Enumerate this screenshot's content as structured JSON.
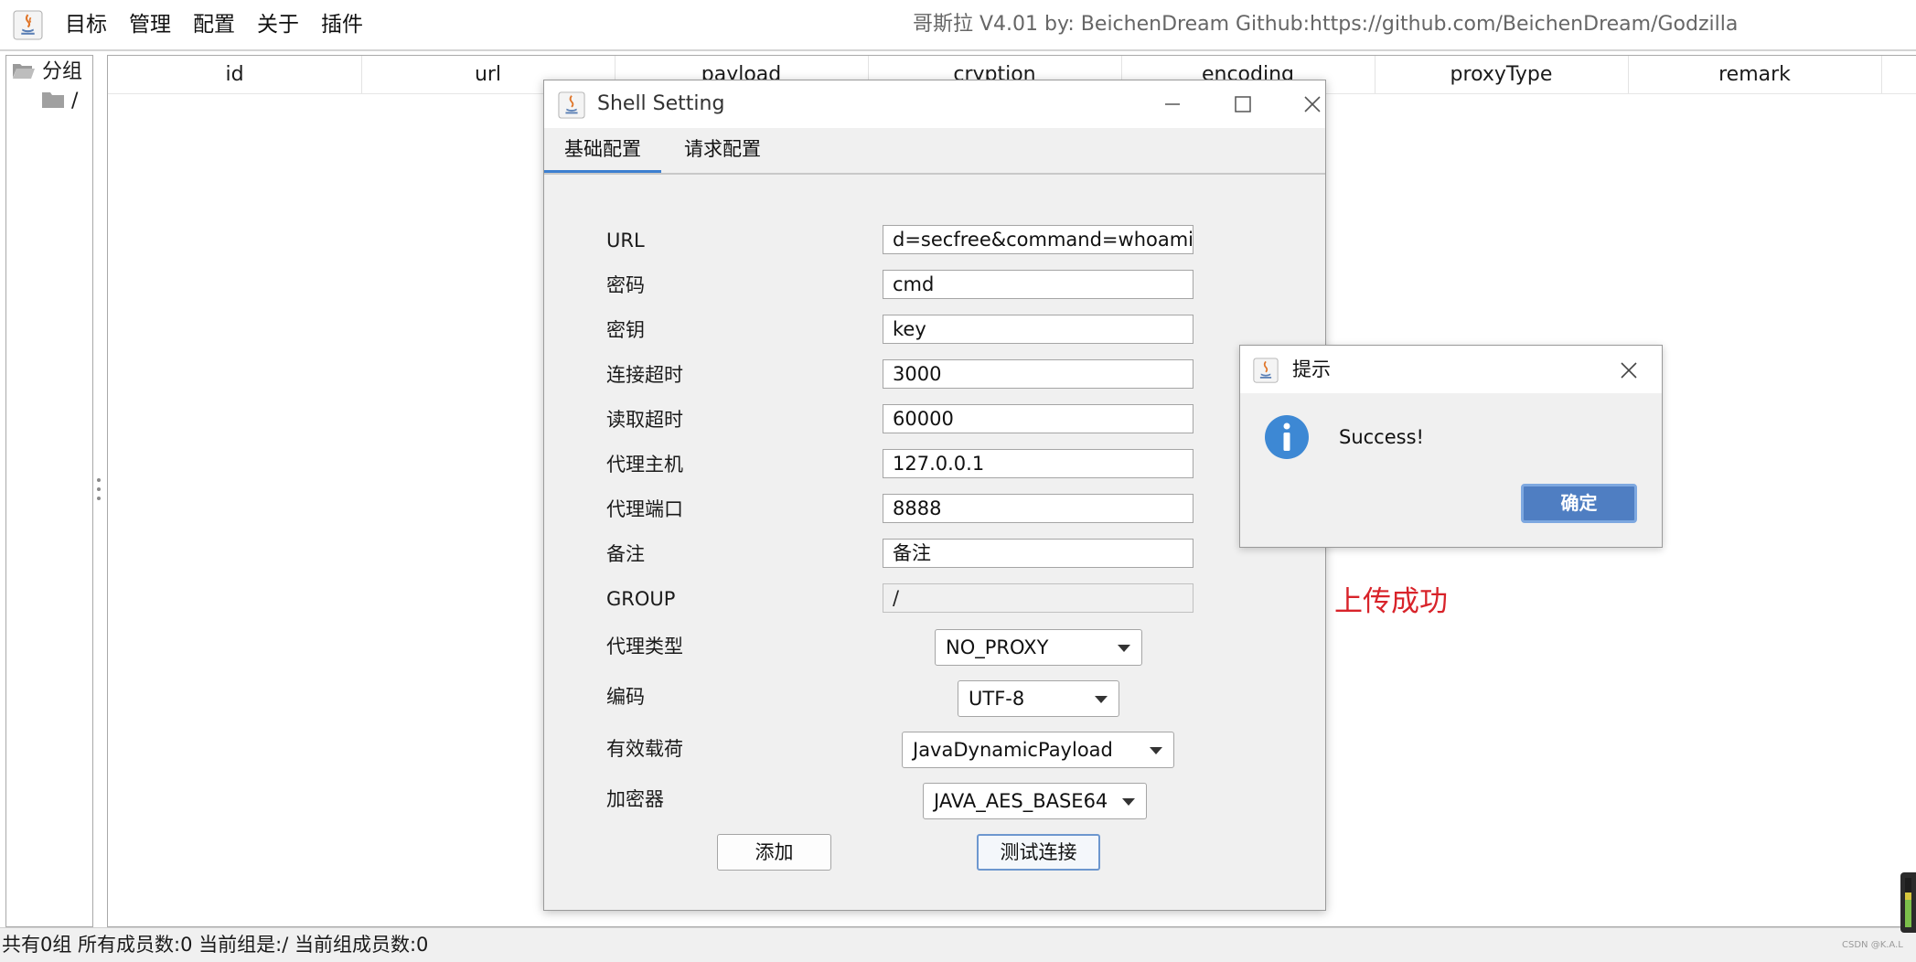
{
  "menubar": {
    "items": [
      "目标",
      "管理",
      "配置",
      "关于",
      "插件"
    ],
    "app_title": "哥斯拉    V4.01 by: BeichenDream Github:https://github.com/BeichenDream/Godzilla"
  },
  "tree": {
    "root_label": "分组",
    "child_label": "/"
  },
  "table": {
    "columns": [
      "id",
      "url",
      "payload",
      "cryption",
      "encoding",
      "proxyType",
      "remark"
    ]
  },
  "shell_dialog": {
    "title": "Shell Setting",
    "tabs": [
      "基础配置",
      "请求配置"
    ],
    "fields": [
      {
        "label": "URL",
        "value": "d=secfree&command=whoami"
      },
      {
        "label": "密码",
        "value": "cmd"
      },
      {
        "label": "密钥",
        "value": "key"
      },
      {
        "label": "连接超时",
        "value": "3000"
      },
      {
        "label": "读取超时",
        "value": "60000"
      },
      {
        "label": "代理主机",
        "value": "127.0.0.1"
      },
      {
        "label": "代理端口",
        "value": "8888"
      },
      {
        "label": "备注",
        "value": "备注"
      },
      {
        "label": "GROUP",
        "value": "/"
      }
    ],
    "selects": [
      {
        "label": "代理类型",
        "value": "NO_PROXY"
      },
      {
        "label": "编码",
        "value": "UTF-8"
      },
      {
        "label": "有效载荷",
        "value": "JavaDynamicPayload"
      },
      {
        "label": "加密器",
        "value": "JAVA_AES_BASE64"
      }
    ],
    "add_button": "添加",
    "test_button": "测试连接"
  },
  "message_dialog": {
    "title": "提示",
    "message": "Success!",
    "ok_button": "确定"
  },
  "annotation": "上传成功",
  "statusbar": {
    "text": "共有0组 所有成员数:0 当前组是:/ 当前组成员数:0",
    "watermark": "CSDN @K.A.L"
  },
  "colors": {
    "tab_accent": "#3c7fd0",
    "ok_button": "#4f7ec2",
    "info_icon": "#3d88d4",
    "annotation": "#d8232a"
  }
}
